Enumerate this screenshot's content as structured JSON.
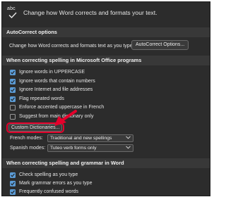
{
  "header": {
    "text": "Change how Word corrects and formats your text.",
    "icon": "abc-check-icon"
  },
  "autocorrect": {
    "title": "AutoCorrect options",
    "label": "Change how Word corrects and formats text as you type:",
    "button": "AutoCorrect Options..."
  },
  "spelling": {
    "title": "When correcting spelling in Microsoft Office programs",
    "items": [
      {
        "label": "Ignore words in UPPERCASE",
        "checked": true
      },
      {
        "label": "Ignore words that contain numbers",
        "checked": true
      },
      {
        "label": "Ignore Internet and file addresses",
        "checked": true
      },
      {
        "label": "Flag repeated words",
        "checked": true
      },
      {
        "label": "Enforce accented uppercase in French",
        "checked": false
      },
      {
        "label": "Suggest from main dictionary only",
        "checked": false
      }
    ],
    "custom_dictionaries_button": "Custom Dictionaries...",
    "french_modes_label": "French modes:",
    "french_modes_value": "Traditional and new spellings",
    "spanish_modes_label": "Spanish modes:",
    "spanish_modes_value": "Tuteo verb forms only"
  },
  "grammar": {
    "title": "When correcting spelling and grammar in Word",
    "items": [
      {
        "label": "Check spelling as you type",
        "checked": true
      },
      {
        "label": "Mark grammar errors as you type",
        "checked": true
      },
      {
        "label": "Frequently confused words",
        "checked": true
      }
    ]
  },
  "colors": {
    "panel_bg": "#2c2c2c",
    "section_bg": "#383838",
    "checkbox_accent": "#5b9bd5",
    "annotation_red": "#e5002b"
  }
}
